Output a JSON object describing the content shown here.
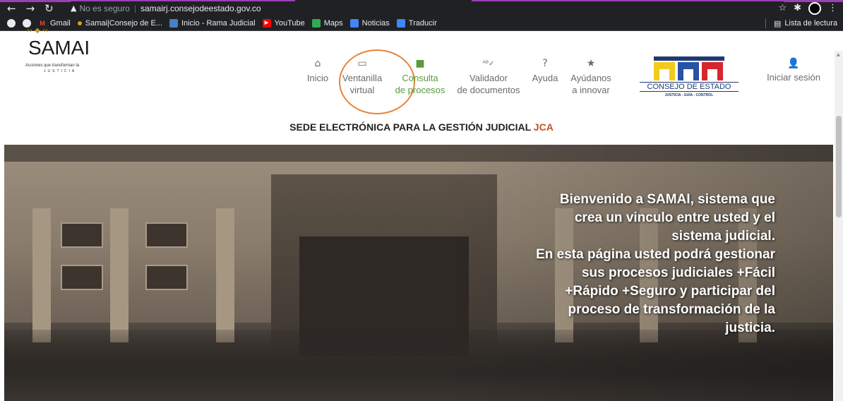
{
  "browser": {
    "omnibox": {
      "security_label": "No es seguro",
      "url": "samairj.consejodeestado.gov.co"
    },
    "reading_list": "Lista de lectura",
    "bookmarks": [
      {
        "label": "",
        "icon": "chrome-icon"
      },
      {
        "label": "",
        "icon": "chrome-icon"
      },
      {
        "label": "Gmail",
        "icon": "gmail-icon"
      },
      {
        "label": "Samai|Consejo de E...",
        "icon": "samai-icon"
      },
      {
        "label": "Inicio - Rama Judicial",
        "icon": "rama-icon"
      },
      {
        "label": "YouTube",
        "icon": "youtube-icon"
      },
      {
        "label": "Maps",
        "icon": "maps-icon"
      },
      {
        "label": "Noticias",
        "icon": "news-icon"
      },
      {
        "label": "Traducir",
        "icon": "translate-icon"
      }
    ]
  },
  "site": {
    "logo": {
      "title": "SAMAI",
      "tagline": "Acciones que transforman la",
      "tagline2": "JUSTICIA"
    },
    "menu": [
      {
        "line1": "Inicio",
        "line2": "",
        "icon": "home-icon"
      },
      {
        "line1": "Ventanilla",
        "line2": "virtual",
        "icon": "inbox-icon"
      },
      {
        "line1": "Consulta",
        "line2": "de procesos",
        "icon": "folder-icon"
      },
      {
        "line1": "Validador",
        "line2": "de documentos",
        "icon": "spellcheck-icon"
      },
      {
        "line1": "Ayuda",
        "line2": "",
        "icon": "help-icon"
      },
      {
        "line1": "Ayúdanos",
        "line2": "a innovar",
        "icon": "star-icon"
      }
    ],
    "consejo": {
      "name": "CONSEJO DE ESTADO",
      "motto": "JUSTICIA - GUÍA - CONTROL"
    },
    "login": "Iniciar sesión",
    "subtitle": {
      "main": "SEDE ELECTRÓNICA PARA LA GESTIÓN JUDICIAL",
      "accent": "JCA"
    },
    "welcome": {
      "lines": [
        "Bienvenido a SAMAI, sistema que",
        "crea un vinculo entre usted y el",
        "sistema judicial.",
        "En esta página usted podrá gestionar",
        "sus procesos judiciales +Fácil",
        "+Rápido +Seguro y participar del",
        "proceso de transformación de la",
        "justicia."
      ]
    }
  },
  "colors": {
    "active_menu": "#5a9a3c",
    "accent": "#c0532a",
    "annotation_circle": "#e8833a"
  }
}
